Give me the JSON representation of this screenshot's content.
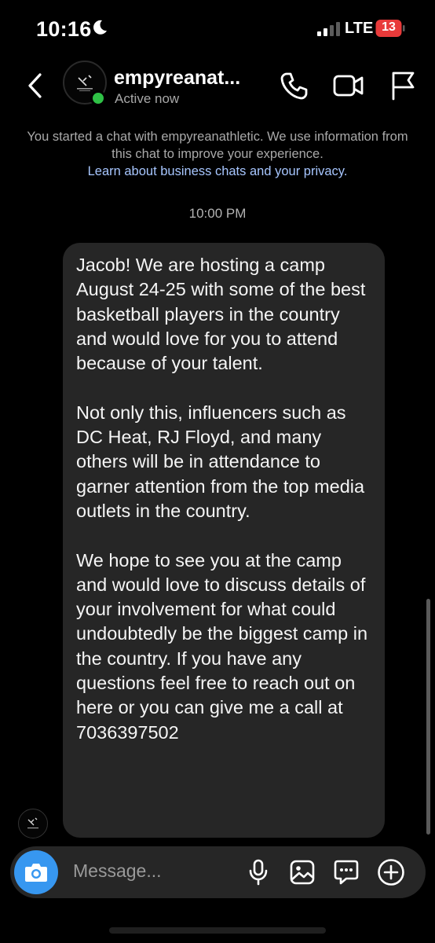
{
  "status_bar": {
    "time": "10:16",
    "network": "LTE",
    "battery": "13",
    "icons": [
      "moon-icon",
      "signal-icon",
      "battery-icon"
    ]
  },
  "header": {
    "back_icon": "chevron-left-icon",
    "contact_name": "empyreanat...",
    "status": "Active now",
    "actions": [
      "phone-icon",
      "video-camera-icon",
      "flag-icon"
    ],
    "active_color": "#2fc146"
  },
  "notice": {
    "text": "You started a chat with empyreanathletic. We use information from this chat to improve your experience.",
    "link": "Learn about business chats and your privacy."
  },
  "conversation": {
    "timestamp": "10:00 PM",
    "message": {
      "paragraphs": [
        "Jacob! We are hosting a camp August 24-25 with some of the best basketball players in the country and would love for you to attend because of your talent.",
        "Not only this, influencers such as DC Heat, RJ Floyd, and many others will be in attendance to garner attention from the top media outlets in the country.",
        "We hope to see you at the camp and would love to discuss details of your involvement for what could undoubtedly be the biggest camp in the country. If you have any questions feel free to reach out on here or you can give me a call at 7036397502"
      ]
    }
  },
  "composer": {
    "placeholder": "Message...",
    "icons": [
      "camera-icon",
      "microphone-icon",
      "gallery-icon",
      "sticker-icon",
      "plus-icon"
    ],
    "accent": "#3797f0"
  }
}
